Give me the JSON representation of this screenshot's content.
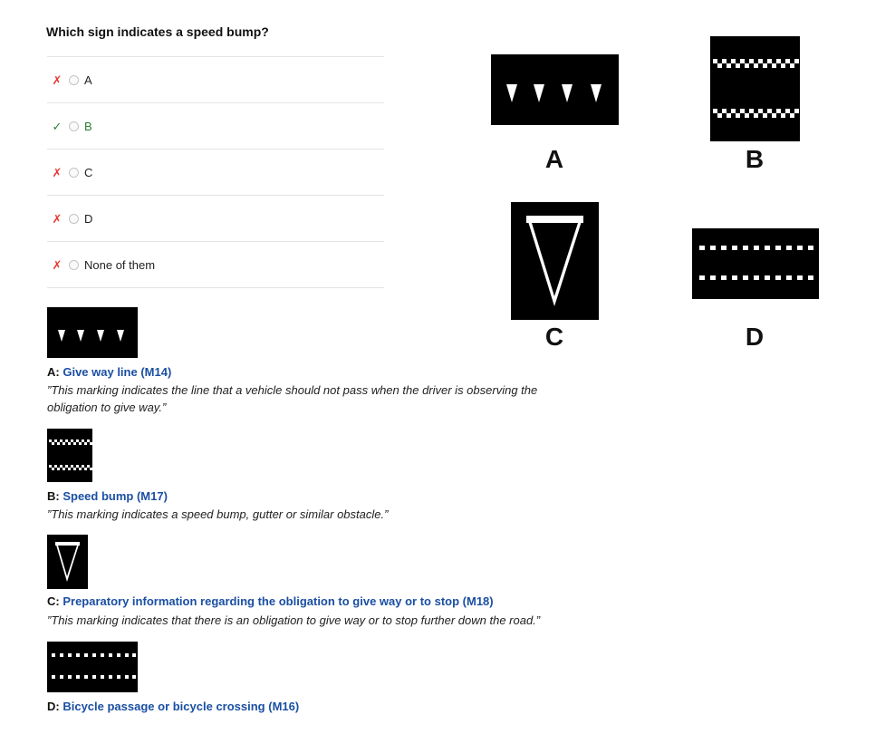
{
  "question": "Which sign indicates a speed bump?",
  "options": [
    {
      "label": "A",
      "mark": "✗",
      "correct": false
    },
    {
      "label": "B",
      "mark": "✓",
      "correct": true
    },
    {
      "label": "C",
      "mark": "✗",
      "correct": false
    },
    {
      "label": "D",
      "mark": "✗",
      "correct": false
    },
    {
      "label": "None of them",
      "mark": "✗",
      "correct": false
    }
  ],
  "signs": {
    "a_label": "A",
    "b_label": "B",
    "c_label": "C",
    "d_label": "D"
  },
  "explanations": [
    {
      "letter": "A:",
      "title": "Give way line (M14)",
      "quote": "”This marking indicates the line that a vehicle should not pass when the driver is observing the obligation to give way.”"
    },
    {
      "letter": "B:",
      "title": "Speed bump (M17)",
      "quote": "”This marking indicates a speed bump, gutter or similar obstacle.”"
    },
    {
      "letter": "C:",
      "title": "Preparatory information regarding the obligation to give way or to stop (M18)",
      "quote": "”This marking indicates that there is an obligation to give way or to stop further down the road.”"
    },
    {
      "letter": "D:",
      "title": "Bicycle passage or bicycle crossing (M16)",
      "quote": ""
    }
  ],
  "colors": {
    "wrong": "#e53935",
    "correct": "#2e7d32",
    "link": "#1a4fa3"
  }
}
